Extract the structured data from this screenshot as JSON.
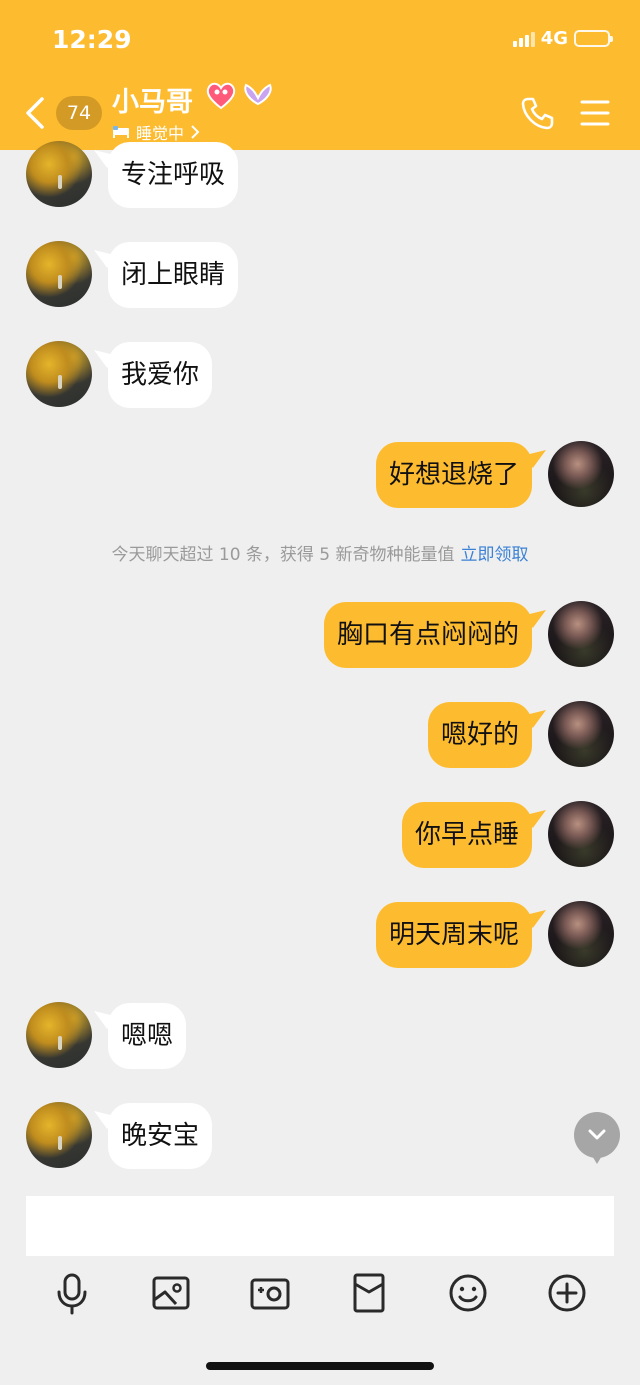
{
  "status_bar": {
    "time": "12:29",
    "network": "4G"
  },
  "header": {
    "unread_count": "74",
    "contact_name": "小马哥",
    "status": "睡觉中",
    "status_icon": "bed-icon"
  },
  "messages": [
    {
      "side": "in",
      "text": "专注呼吸"
    },
    {
      "side": "in",
      "text": "闭上眼睛"
    },
    {
      "side": "in",
      "text": "我爱你"
    },
    {
      "side": "out",
      "text": "好想退烧了"
    },
    {
      "side": "out",
      "text": "胸口有点闷闷的"
    },
    {
      "side": "out",
      "text": "嗯好的"
    },
    {
      "side": "out",
      "text": "你早点睡"
    },
    {
      "side": "out",
      "text": "明天周末呢"
    },
    {
      "side": "in",
      "text": "嗯嗯"
    },
    {
      "side": "in",
      "text": "晚安宝"
    }
  ],
  "notice": {
    "text": "今天聊天超过 10 条，获得 5 新奇物种能量值",
    "link": "立即领取"
  },
  "toolbar": [
    "microphone-icon",
    "image-icon",
    "camera-icon",
    "red-envelope-icon",
    "emoji-icon",
    "plus-icon"
  ],
  "colors": {
    "accent": "#fdbb2f",
    "link": "#3b82d6"
  }
}
